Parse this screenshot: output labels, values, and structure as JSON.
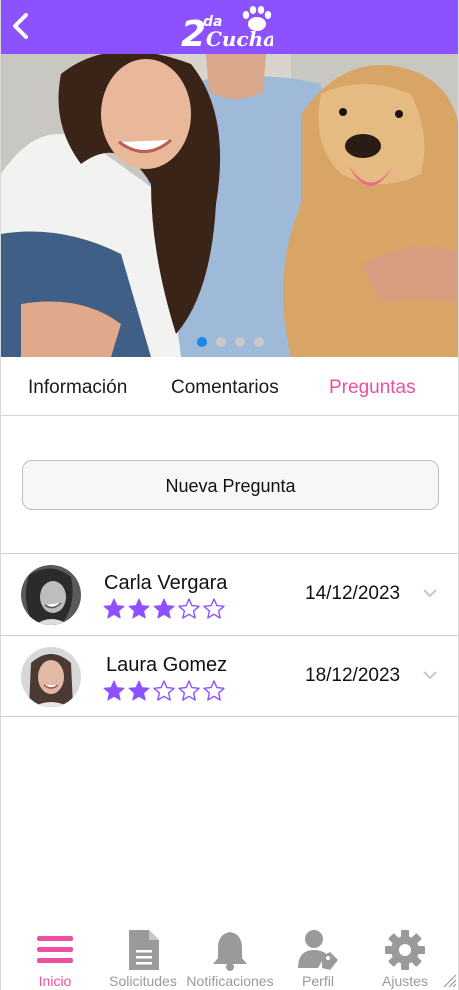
{
  "header": {
    "logo_text": "2 da Cucha"
  },
  "carousel": {
    "slide_count": 4,
    "active_index": 0
  },
  "tabs": [
    {
      "label": "Información",
      "active": false
    },
    {
      "label": "Comentarios",
      "active": false
    },
    {
      "label": "Preguntas",
      "active": true
    }
  ],
  "new_question": {
    "label": "Nueva Pregunta"
  },
  "questions": [
    {
      "name": "Carla Vergara",
      "rating": 3,
      "max_rating": 5,
      "date": "14/12/2023"
    },
    {
      "name": "Laura Gomez",
      "rating": 2,
      "max_rating": 5,
      "date": "18/12/2023"
    }
  ],
  "bottom_nav": [
    {
      "label": "Inicio",
      "icon": "menu-icon",
      "active": true
    },
    {
      "label": "Solicitudes",
      "icon": "document-icon",
      "active": false
    },
    {
      "label": "Notificaciones",
      "icon": "bell-icon",
      "active": false
    },
    {
      "label": "Perfil",
      "icon": "user-tag-icon",
      "active": false
    },
    {
      "label": "Ajustes",
      "icon": "gear-icon",
      "active": false
    }
  ],
  "colors": {
    "primary": "#8c52ff",
    "accent": "#ee4fa0",
    "star": "#8c52ff",
    "dot_active": "#1e88e5"
  }
}
